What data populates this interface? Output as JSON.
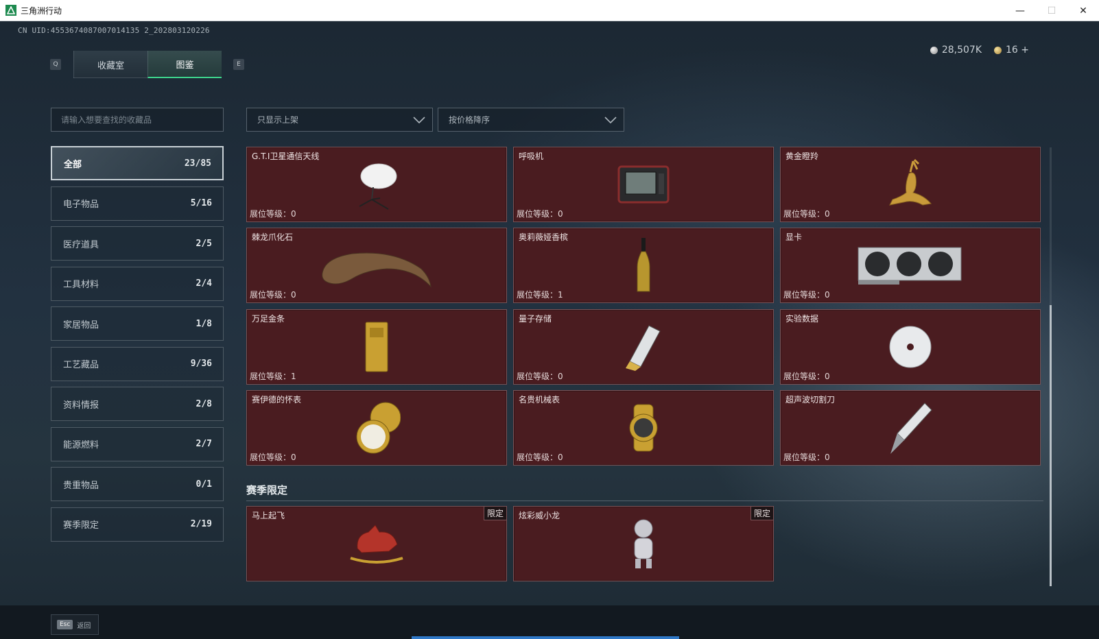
{
  "window": {
    "title": "三角洲行动",
    "minimize": "—",
    "maximize": "☐",
    "close": "✕"
  },
  "header": {
    "uid": "CN UID:4553674087007014135 2_202803120226",
    "key_prev": "Q",
    "key_next": "E",
    "tabs": [
      {
        "label": "收藏室",
        "active": false
      },
      {
        "label": "图鉴",
        "active": true
      }
    ],
    "currency": [
      {
        "icon": "silver-coin-icon",
        "value": "28,507K"
      },
      {
        "icon": "gold-coin-icon",
        "value": "16 +"
      }
    ]
  },
  "sidebar": {
    "search_placeholder": "请输入想要查找的收藏品",
    "categories": [
      {
        "label": "全部",
        "count": "23/85",
        "active": true
      },
      {
        "label": "电子物品",
        "count": "5/16"
      },
      {
        "label": "医疗道具",
        "count": "2/5"
      },
      {
        "label": "工具材料",
        "count": "2/4"
      },
      {
        "label": "家居物品",
        "count": "1/8"
      },
      {
        "label": "工艺藏品",
        "count": "9/36"
      },
      {
        "label": "资料情报",
        "count": "2/8"
      },
      {
        "label": "能源燃料",
        "count": "2/7"
      },
      {
        "label": "贵重物品",
        "count": "0/1"
      },
      {
        "label": "赛季限定",
        "count": "2/19"
      }
    ]
  },
  "filters": {
    "availability": "只显示上架",
    "sort": "按价格降序"
  },
  "level_label": "展位等级：",
  "items": [
    {
      "name": "G.T.I卫星通信天线",
      "level": "0",
      "icon": "satellite-dish-icon"
    },
    {
      "name": "呼吸机",
      "level": "0",
      "icon": "ventilator-icon"
    },
    {
      "name": "黄金瞪羚",
      "level": "0",
      "icon": "golden-gazelle-icon"
    },
    {
      "name": "棘龙爪化石",
      "level": "0",
      "icon": "claw-fossil-icon"
    },
    {
      "name": "奥莉薇娅香槟",
      "level": "1",
      "icon": "champagne-bottle-icon"
    },
    {
      "name": "显卡",
      "level": "0",
      "icon": "graphics-card-icon"
    },
    {
      "name": "万足金条",
      "level": "1",
      "icon": "gold-bar-icon"
    },
    {
      "name": "量子存储",
      "level": "0",
      "icon": "quantum-storage-icon"
    },
    {
      "name": "实验数据",
      "level": "0",
      "icon": "data-disc-icon"
    },
    {
      "name": "赛伊德的怀表",
      "level": "0",
      "icon": "pocket-watch-icon"
    },
    {
      "name": "名贵机械表",
      "level": "0",
      "icon": "wristwatch-icon"
    },
    {
      "name": "超声波切割刀",
      "level": "0",
      "icon": "ultrasonic-knife-icon"
    }
  ],
  "season": {
    "title": "赛季限定",
    "items": [
      {
        "name": "马上起飞",
        "tag": "限定",
        "icon": "rocking-horse-icon"
      },
      {
        "name": "炫彩威小龙",
        "tag": "限定",
        "icon": "dragon-figure-icon"
      }
    ]
  },
  "footer": {
    "esc_key": "Esc",
    "esc_label": "返回"
  },
  "colors": {
    "card_bg": "#4a1c20",
    "accent_green": "#3ed48c",
    "card_border": "#7b5357"
  }
}
